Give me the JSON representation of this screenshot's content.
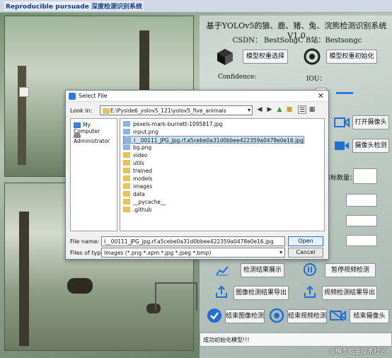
{
  "window": {
    "title": "Reproducible pursuade 深度检测识别系统",
    "logo_text": "Reproducible pursuade"
  },
  "panel": {
    "title": "基于YOLOv5的狼、鹿、猪、兔、浣熊检测识别系统V1.0",
    "credits": "CSDN： BestSongC   B站：Bestsongc",
    "select_weights": "模型权重选择",
    "init_weights": "模型权重初始化",
    "confidence_label": "Confidence:",
    "iou_label": "IOU：",
    "confidence_value": "",
    "iou_value": "",
    "open_camera": "打开摄像头",
    "camera_detect": "摄像头检测",
    "target_count_label": "目标数量：",
    "show_results": "检测结果展示",
    "pause_video": "暂停视频检测",
    "export_image_results": "图像检测结果导出",
    "export_video_results": "视频检测结果导出",
    "end_image_detect": "结束图像检测",
    "end_video_detect": "结束视频检测",
    "end_camera": "结束摄像头",
    "status_text": "成功初始化模型!!!",
    "watermark": "@稀土掘金技术社区"
  },
  "dialog": {
    "title": "Select File",
    "look_in_label": "Look in:",
    "path": "E:\\Pyside6_yolov5_121\\yolov5_five_animals",
    "sidebar": [
      {
        "label": "My Computer",
        "icon": "computer-icon"
      },
      {
        "label": "Administrator",
        "icon": "user-icon"
      }
    ],
    "files": [
      {
        "name": "pexels-mark-burnett-1095817.jpg",
        "type": "image"
      },
      {
        "name": "input.png",
        "type": "image"
      },
      {
        "name": "I__00111_JPG_jpg.rf.a5cebe0a31d0bbee422359a0478e0e16.jpg",
        "type": "image",
        "selected": true
      },
      {
        "name": "bg.png",
        "type": "image"
      },
      {
        "name": "video",
        "type": "folder"
      },
      {
        "name": "utils",
        "type": "folder"
      },
      {
        "name": "trained",
        "type": "folder"
      },
      {
        "name": "models",
        "type": "folder"
      },
      {
        "name": "images",
        "type": "folder"
      },
      {
        "name": "data",
        "type": "folder"
      },
      {
        "name": "__pycache__",
        "type": "folder"
      },
      {
        "name": ".github",
        "type": "folder"
      }
    ],
    "file_name_label": "File name:",
    "file_name_value": "I__00111_JPG_jpg.rf.a5cebe0a31d0bbee422359a0478e0e16.jpg",
    "file_type_label": "Files of type:",
    "file_type_value": "Images (*.png *.xpm *.jpg *.jpeg *.bmp)",
    "open_button": "Open",
    "cancel_button": "Cancel"
  },
  "colors": {
    "accent": "#1f6fd6",
    "selection": "#cce4f7",
    "folder": "#e7c258"
  }
}
